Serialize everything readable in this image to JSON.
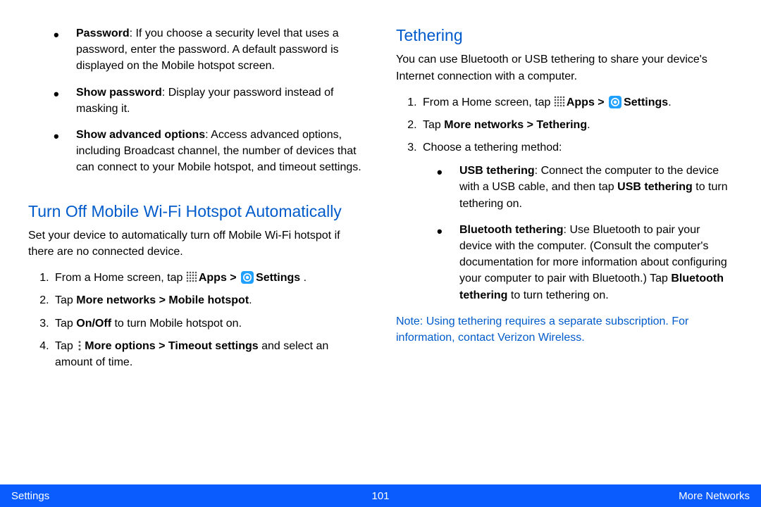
{
  "left": {
    "bullets": [
      {
        "bold": "Password",
        "text": ": If you choose a security level that uses a password, enter the password. A default password is displayed on the Mobile hotspot screen."
      },
      {
        "bold": "Show password",
        "text": ": Display your password instead of masking it."
      },
      {
        "bold": "Show advanced options",
        "text": ": Access advanced options, including Broadcast channel, the number of devices that can connect to your Mobile hotspot, and timeout settings."
      }
    ],
    "heading": "Turn Off Mobile Wi-Fi Hotspot Automatically",
    "intro": "Set your device to automatically turn off Mobile Wi-Fi hotspot if there are no connected device.",
    "steps": {
      "s1_pre": "From a Home screen, tap ",
      "s1_apps": "Apps > ",
      "s1_settings": "Settings",
      "s1_post": " .",
      "s2_pre": "Tap ",
      "s2_bold": "More networks > Mobile hotspot",
      "s2_post": ".",
      "s3_pre": "Tap ",
      "s3_bold": "On/Off",
      "s3_post": " to turn Mobile hotspot on.",
      "s4_pre": "Tap ",
      "s4_bold": "More options > Timeout settings",
      "s4_post": " and select an amount of time."
    }
  },
  "right": {
    "heading": "Tethering",
    "intro": "You can use Bluetooth or USB tethering to share your device's Internet connection with a computer.",
    "steps": {
      "s1_pre": "From a Home screen, tap ",
      "s1_apps": "Apps > ",
      "s1_settings": "Settings",
      "s1_post": ".",
      "s2_pre": "Tap ",
      "s2_bold": "More networks > Tethering",
      "s2_post": ".",
      "s3": "Choose a tethering method:"
    },
    "sub": [
      {
        "bold1": "USB tethering",
        "t1": ": Connect the computer to the device with a USB cable, and then tap ",
        "bold2": "USB tethering",
        "t2": " to turn tethering on."
      },
      {
        "bold1": "Bluetooth tethering",
        "t1": ": Use Bluetooth to pair your device with the computer. (Consult the computer's documentation for more information about configuring your computer to pair with Bluetooth.) Tap ",
        "bold2": "Bluetooth tethering",
        "t2": " to turn tethering on."
      }
    ],
    "note_label": "Note",
    "note_text": ": Using tethering requires a separate subscription. For information, contact Verizon Wireless."
  },
  "footer": {
    "left": "Settings",
    "center": "101",
    "right": "More Networks"
  }
}
